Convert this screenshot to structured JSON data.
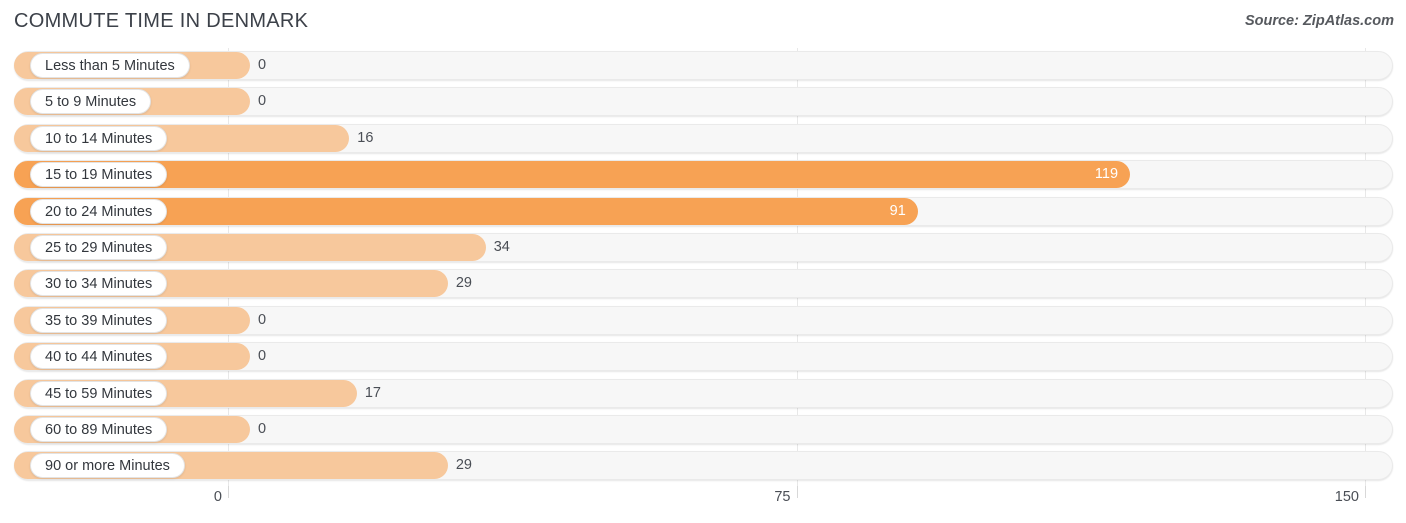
{
  "header": {
    "title": "COMMUTE TIME IN DENMARK",
    "source": "Source: ZipAtlas.com"
  },
  "chart_data": {
    "type": "bar",
    "orientation": "horizontal",
    "title": "COMMUTE TIME IN DENMARK",
    "xlabel": "",
    "ylabel": "",
    "xlim": [
      0,
      150
    ],
    "ticks": [
      "0",
      "75",
      "150"
    ],
    "tick_values": [
      0,
      75,
      150
    ],
    "grid": true,
    "legend": null,
    "categories": [
      "Less than 5 Minutes",
      "5 to 9 Minutes",
      "10 to 14 Minutes",
      "15 to 19 Minutes",
      "20 to 24 Minutes",
      "25 to 29 Minutes",
      "30 to 34 Minutes",
      "35 to 39 Minutes",
      "40 to 44 Minutes",
      "45 to 59 Minutes",
      "60 to 89 Minutes",
      "90 or more Minutes"
    ],
    "values": [
      0,
      0,
      16,
      119,
      91,
      34,
      29,
      0,
      0,
      17,
      0,
      29
    ],
    "value_labels": [
      "0",
      "0",
      "16",
      "119",
      "91",
      "34",
      "29",
      "0",
      "0",
      "17",
      "0",
      "29"
    ],
    "colors": {
      "bar_light": "#f7c89c",
      "bar_strong": "#f7a254",
      "track": "#f7f7f7",
      "grid": "#e8e8e8",
      "label_text": "#33373d",
      "value_text": "#4a4e55",
      "value_text_inside": "#ffffff"
    }
  }
}
